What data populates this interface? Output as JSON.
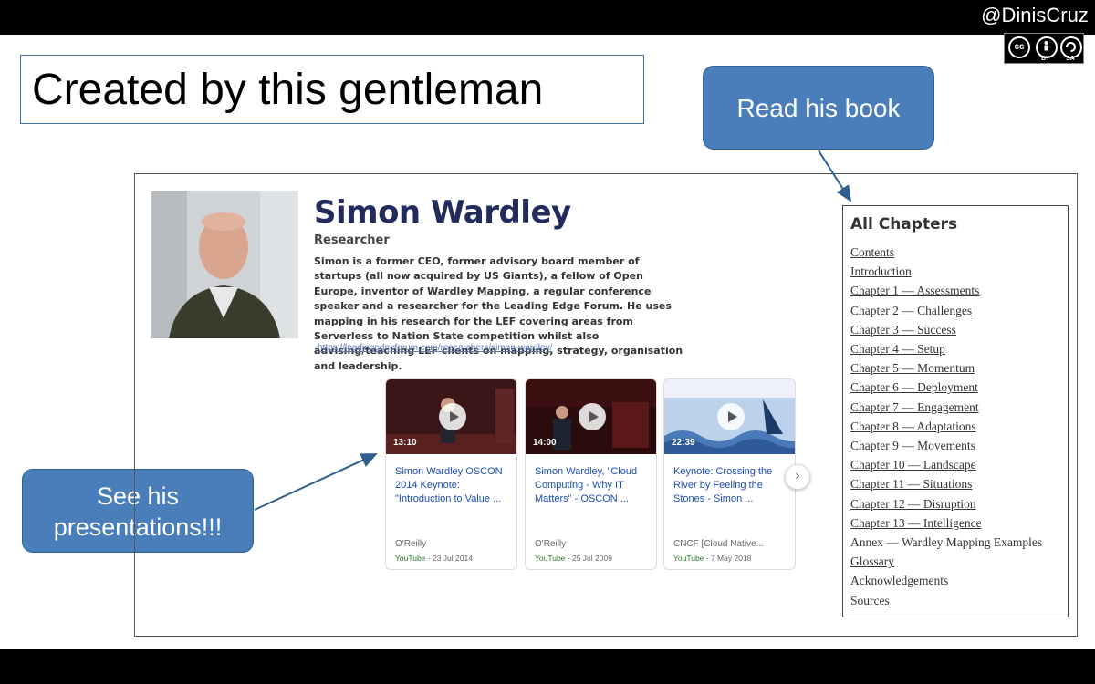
{
  "slide": {
    "title": "Created by this gentleman",
    "handle": "@DinisCruz",
    "license": {
      "cc": "cc",
      "by": "BY",
      "sa": "SA"
    }
  },
  "callouts": {
    "book": "Read his book",
    "presentations_line1": "See his",
    "presentations_line2": "presentations!!!"
  },
  "profile": {
    "name": "Simon Wardley",
    "role": "Researcher",
    "bio": "Simon is a former CEO, former advisory board member of startups (all now acquired by US Giants), a fellow of Open Europe, inventor of Wardley Mapping, a regular conference speaker and a researcher for the Leading Edge Forum. He uses mapping in his research for the LEF covering areas from Serverless to Nation State competition whilst also advising/teaching LEF clients on mapping, strategy, organisation and leadership.",
    "link": "https://leadingedgeforum.com/researchers/simon-wardley/"
  },
  "videos": [
    {
      "duration": "13:10",
      "title": "Simon Wardley OSCON 2014 Keynote: \"Introduction to Value ...",
      "source": "O'Reilly",
      "platform": "YouTube",
      "date": "- 23 Jul 2014"
    },
    {
      "duration": "14:00",
      "title": "Simon Wardley, \"Cloud Computing - Why IT Matters\" - OSCON ...",
      "source": "O'Reilly",
      "platform": "YouTube",
      "date": "- 25 Jul 2009"
    },
    {
      "duration": "22:39",
      "title": "Keynote: Crossing the River by Feeling the Stones - Simon ...",
      "source": "CNCF [Cloud Native...",
      "platform": "YouTube",
      "date": "- 7 May 2018"
    }
  ],
  "book": {
    "heading": "All Chapters",
    "chapters": [
      "Contents",
      "Introduction",
      "Chapter 1 — Assessments",
      "Chapter 2 — Challenges",
      "Chapter 3 — Success",
      "Chapter 4 — Setup",
      "Chapter 5 — Momentum",
      "Chapter 6 — Deployment",
      "Chapter 7 — Engagement",
      "Chapter 8 — Adaptations",
      "Chapter 9 — Movements",
      "Chapter 10 — Landscape",
      "Chapter 11 — Situations",
      "Chapter 12 — Disruption",
      "Chapter 13 — Intelligence",
      "Annex — Wardley Mapping Examples",
      "Glossary",
      "Acknowledgements",
      "Sources"
    ]
  },
  "icons": {
    "next": "chevron-right-icon",
    "play": "play-icon"
  }
}
